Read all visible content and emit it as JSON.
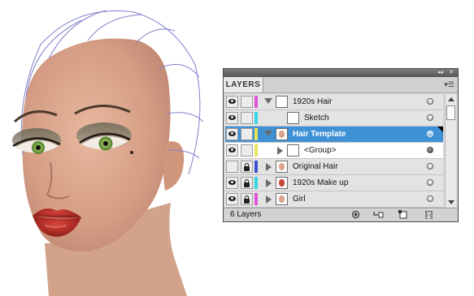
{
  "panel": {
    "tab_label": "LAYERS",
    "collapse_icon": "double-chevron-left-icon",
    "close_icon": "close-icon",
    "menu_icon": "panel-menu-icon",
    "footer_count": "6 Layers",
    "footer_buttons": [
      "make-clipping-mask",
      "create-new-sublayer",
      "create-new-layer",
      "delete-layer"
    ]
  },
  "layers": [
    {
      "name": "1920s Hair",
      "visible": true,
      "locked": false,
      "color": "#e052d8",
      "expanded": true,
      "level": 0,
      "selected": false
    },
    {
      "name": "Sketch",
      "visible": true,
      "locked": false,
      "color": "#33d6e6",
      "expanded": false,
      "level": 1,
      "selected": false
    },
    {
      "name": "Hair Template",
      "visible": true,
      "locked": false,
      "color": "#e8e45a",
      "expanded": true,
      "level": 0,
      "selected": true
    },
    {
      "name": "<Group>",
      "visible": true,
      "locked": false,
      "color": "#e8e45a",
      "expanded": false,
      "level": 1,
      "selected": false
    },
    {
      "name": "Original Hair",
      "visible": false,
      "locked": true,
      "color": "#3f52d6",
      "expanded": false,
      "level": 0,
      "selected": false
    },
    {
      "name": "1920s Make up",
      "visible": true,
      "locked": true,
      "color": "#33d6e6",
      "expanded": false,
      "level": 0,
      "selected": false
    },
    {
      "name": "Girl",
      "visible": true,
      "locked": true,
      "color": "#e052d8",
      "expanded": false,
      "level": 0,
      "selected": false
    }
  ],
  "colors": {
    "selection": "#3f91d6",
    "skin": "#d9a48a",
    "lips": "#b92d24",
    "eyes": "#7fb34a",
    "guides": "#7a7ac8"
  }
}
